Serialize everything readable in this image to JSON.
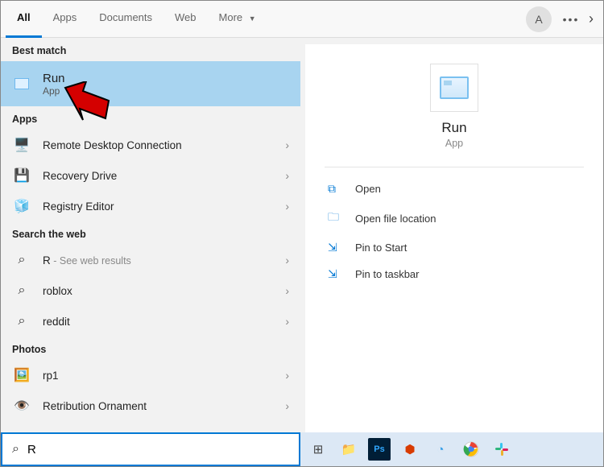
{
  "tabs": {
    "all": "All",
    "apps": "Apps",
    "documents": "Documents",
    "web": "Web",
    "more": "More"
  },
  "avatar": "A",
  "sections": {
    "best": "Best match",
    "apps": "Apps",
    "web": "Search the web",
    "photos": "Photos"
  },
  "best": {
    "title": "Run",
    "subtitle": "App"
  },
  "apps": [
    {
      "label": "Remote Desktop Connection"
    },
    {
      "label": "Recovery Drive"
    },
    {
      "label": "Registry Editor"
    }
  ],
  "web": {
    "prefix": "R",
    "hint": " - See web results",
    "items": [
      "roblox",
      "reddit"
    ]
  },
  "photos": [
    "rp1",
    "Retribution Ornament"
  ],
  "detail": {
    "title": "Run",
    "subtitle": "App"
  },
  "actions": {
    "open": "Open",
    "location": "Open file location",
    "pin_start": "Pin to Start",
    "pin_taskbar": "Pin to taskbar"
  },
  "search": {
    "value": "R"
  }
}
